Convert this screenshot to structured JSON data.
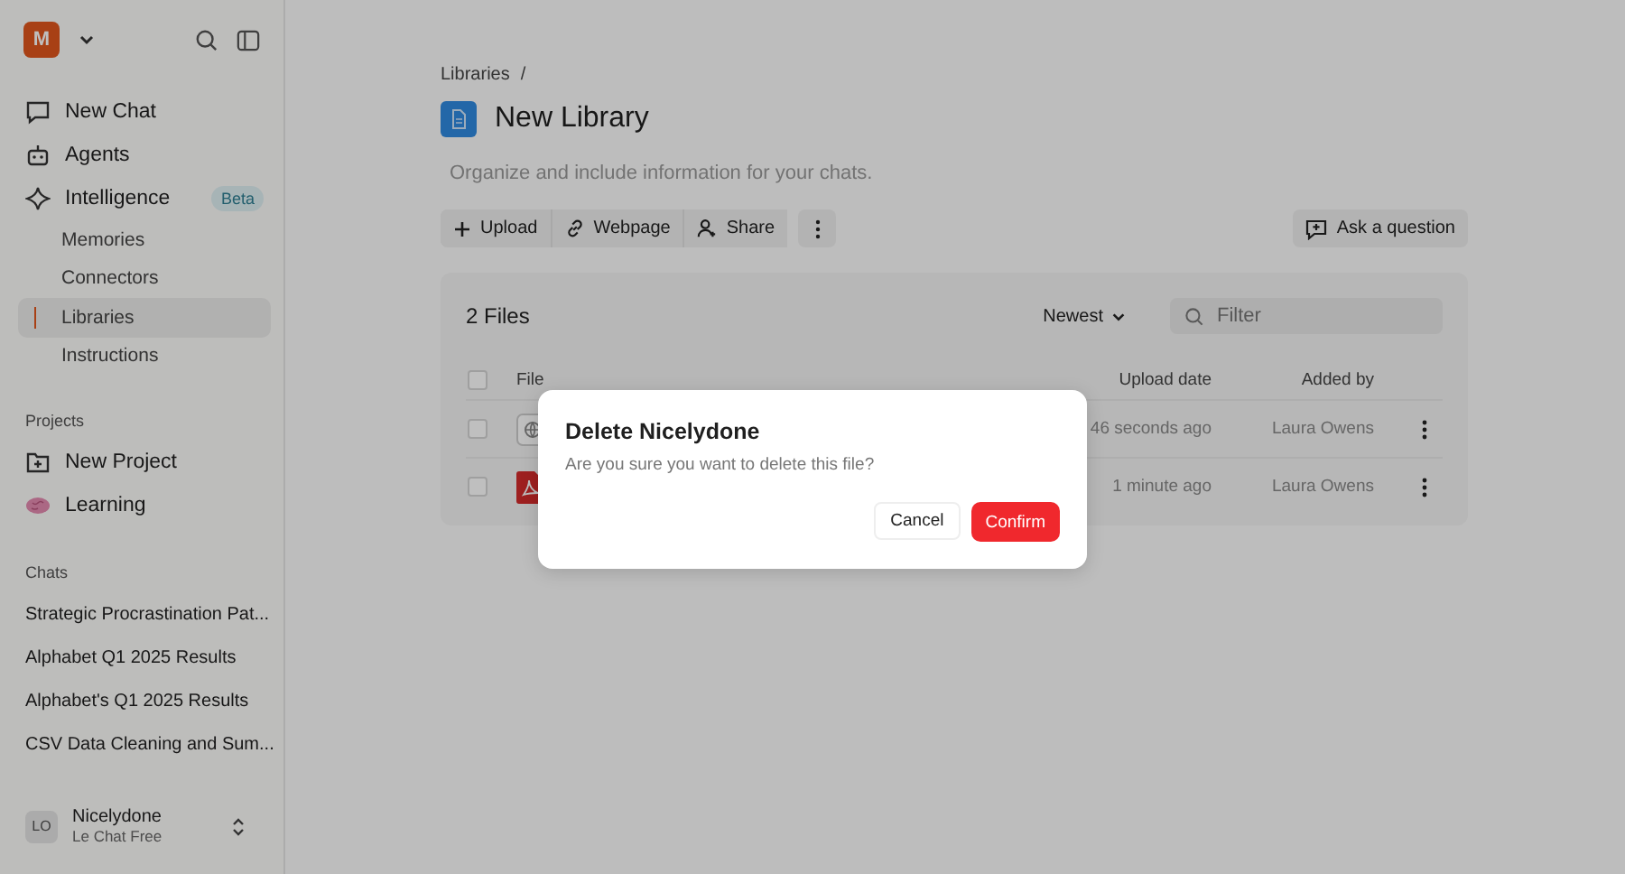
{
  "sidebar": {
    "logo": "M",
    "nav": [
      {
        "label": "New Chat"
      },
      {
        "label": "Agents"
      },
      {
        "label": "Intelligence",
        "badge": "Beta"
      }
    ],
    "sub_items": [
      {
        "label": "Memories",
        "selected": false
      },
      {
        "label": "Connectors",
        "selected": false
      },
      {
        "label": "Libraries",
        "selected": true
      },
      {
        "label": "Instructions",
        "selected": false
      }
    ],
    "projects": {
      "heading": "Projects",
      "items": [
        {
          "label": "New Project"
        },
        {
          "label": "Learning"
        }
      ]
    },
    "chats": {
      "heading": "Chats",
      "items": [
        "Strategic Procrastination Pat...",
        "Alphabet Q1 2025 Results",
        "Alphabet's Q1 2025 Results",
        "CSV Data Cleaning and Sum..."
      ]
    },
    "user": {
      "initials": "LO",
      "name": "Nicelydone",
      "plan": "Le Chat Free"
    }
  },
  "breadcrumb": {
    "label": "Libraries",
    "separator": "/"
  },
  "title": "New Library",
  "description_placeholder": "Organize and include information for your chats.",
  "toolbar": [
    {
      "label": "Upload"
    },
    {
      "label": "Webpage"
    },
    {
      "label": "Share"
    }
  ],
  "ask_button": "Ask a question",
  "files": {
    "count": "2 Files",
    "sort": "Newest",
    "filter_placeholder": "Filter",
    "select_all_checked": false,
    "columns": [
      "File",
      "Upload date",
      "Added by"
    ],
    "rows": [
      {
        "kind": "web",
        "checked": false,
        "upload_date": "46 seconds ago",
        "added_by": "Laura Owens"
      },
      {
        "kind": "pdf",
        "checked": false,
        "upload_date": "1 minute ago",
        "added_by": "Laura Owens"
      }
    ]
  },
  "dialog": {
    "title": "Delete Nicelydone",
    "message": "Are you sure you want to delete this file?",
    "cancel": "Cancel",
    "confirm": "Confirm"
  }
}
